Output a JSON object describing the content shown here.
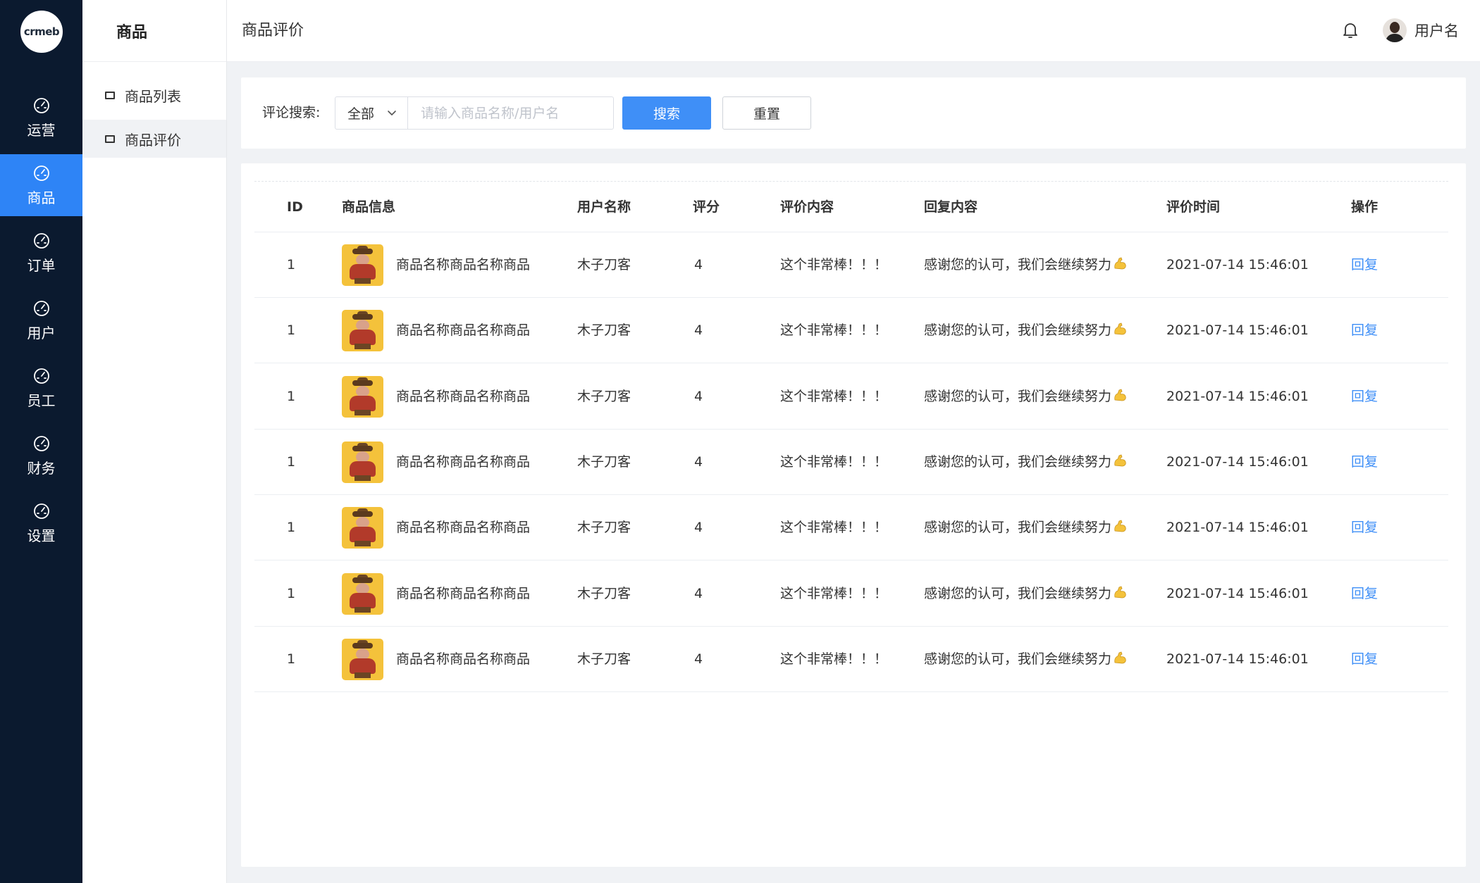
{
  "logo": {
    "text": "crmeb"
  },
  "rail": {
    "items": [
      {
        "label": "运营",
        "active": false
      },
      {
        "label": "商品",
        "active": true
      },
      {
        "label": "订单",
        "active": false
      },
      {
        "label": "用户",
        "active": false
      },
      {
        "label": "员工",
        "active": false
      },
      {
        "label": "财务",
        "active": false
      },
      {
        "label": "设置",
        "active": false
      }
    ]
  },
  "submenu": {
    "title": "商品",
    "items": [
      {
        "label": "商品列表",
        "active": false
      },
      {
        "label": "商品评价",
        "active": true
      }
    ]
  },
  "header": {
    "title": "商品评价",
    "username": "用户名"
  },
  "search": {
    "label": "评论搜索:",
    "select_value": "全部",
    "placeholder": "请输入商品名称/用户名",
    "search_button": "搜索",
    "reset_button": "重置"
  },
  "table": {
    "columns": [
      "ID",
      "商品信息",
      "用户名称",
      "评分",
      "评价内容",
      "回复内容",
      "评价时间",
      "操作"
    ],
    "rows": [
      {
        "id": "1",
        "product": "商品名称商品名称商品",
        "user": "木子刀客",
        "score": "4",
        "comment": "这个非常棒！！！",
        "reply": "感谢您的认可，我们会继续努力",
        "time": "2021-07-14 15:46:01",
        "action": "回复"
      },
      {
        "id": "1",
        "product": "商品名称商品名称商品",
        "user": "木子刀客",
        "score": "4",
        "comment": "这个非常棒！！！",
        "reply": "感谢您的认可，我们会继续努力",
        "time": "2021-07-14 15:46:01",
        "action": "回复"
      },
      {
        "id": "1",
        "product": "商品名称商品名称商品",
        "user": "木子刀客",
        "score": "4",
        "comment": "这个非常棒！！！",
        "reply": "感谢您的认可，我们会继续努力",
        "time": "2021-07-14 15:46:01",
        "action": "回复"
      },
      {
        "id": "1",
        "product": "商品名称商品名称商品",
        "user": "木子刀客",
        "score": "4",
        "comment": "这个非常棒！！！",
        "reply": "感谢您的认可，我们会继续努力",
        "time": "2021-07-14 15:46:01",
        "action": "回复"
      },
      {
        "id": "1",
        "product": "商品名称商品名称商品",
        "user": "木子刀客",
        "score": "4",
        "comment": "这个非常棒！！！",
        "reply": "感谢您的认可，我们会继续努力",
        "time": "2021-07-14 15:46:01",
        "action": "回复"
      },
      {
        "id": "1",
        "product": "商品名称商品名称商品",
        "user": "木子刀客",
        "score": "4",
        "comment": "这个非常棒！！！",
        "reply": "感谢您的认可，我们会继续努力",
        "time": "2021-07-14 15:46:01",
        "action": "回复"
      },
      {
        "id": "1",
        "product": "商品名称商品名称商品",
        "user": "木子刀客",
        "score": "4",
        "comment": "这个非常棒！！！",
        "reply": "感谢您的认可，我们会继续努力",
        "time": "2021-07-14 15:46:01",
        "action": "回复"
      }
    ]
  },
  "icons": {
    "rail_item": "gauge-icon",
    "submenu_item": "window-icon",
    "notification": "bell-icon",
    "select_arrow": "chevron-down-icon",
    "product_thumb": "product-thumbnail",
    "reply_emoji": "flexed-biceps-emoji"
  },
  "colors": {
    "rail_bg": "#0b1a2f",
    "accent": "#2e84f6",
    "link": "#3f8ff7",
    "page_bg": "#f0f2f5"
  }
}
